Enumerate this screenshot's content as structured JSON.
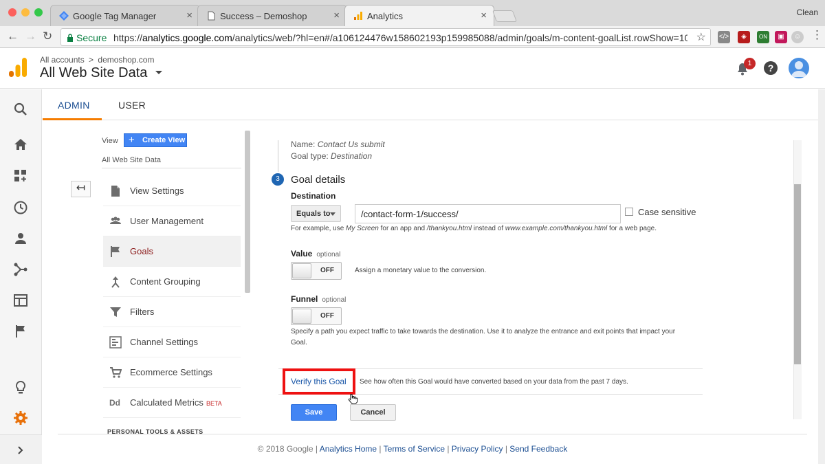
{
  "browser": {
    "profile_name": "Clean",
    "tabs": [
      {
        "title": "Google Tag Manager",
        "icon": "gtm-icon"
      },
      {
        "title": "Success – Demoshop",
        "icon": "page-icon"
      },
      {
        "title": "Analytics",
        "icon": "analytics-icon"
      }
    ],
    "secure_label": "Secure",
    "url_prefix": "https://",
    "url_host": "analytics.google.com",
    "url_path": "/analytics/web/?hl=en#/a106124476w158602193p159985088/admin/goals/m-content-goalList.rowShow=10..."
  },
  "header": {
    "all_accounts": "All accounts",
    "breadcrumb_separator": ">",
    "account": "demoshop.com",
    "view_title": "All Web Site Data",
    "notification_count": "1"
  },
  "admin_tabs": {
    "admin": "ADMIN",
    "user": "USER"
  },
  "view_column": {
    "label": "View",
    "create_view": "Create View",
    "view_name": "All Web Site Data",
    "menu": [
      {
        "label": "View Settings",
        "icon": "document-icon"
      },
      {
        "label": "User Management",
        "icon": "people-icon"
      },
      {
        "label": "Goals",
        "icon": "flag-icon"
      },
      {
        "label": "Content Grouping",
        "icon": "grouping-icon"
      },
      {
        "label": "Filters",
        "icon": "filter-icon"
      },
      {
        "label": "Channel Settings",
        "icon": "channel-icon"
      },
      {
        "label": "Ecommerce Settings",
        "icon": "cart-icon"
      },
      {
        "label": "Calculated Metrics",
        "icon": "dd-icon",
        "badge": "BETA"
      }
    ],
    "section_heading": "PERSONAL TOOLS & ASSETS"
  },
  "goal": {
    "name_label": "Name:",
    "name_value": "Contact Us submit",
    "type_label": "Goal type:",
    "type_value": "Destination",
    "step_number": "3",
    "section_title": "Goal details",
    "destination_label": "Destination",
    "match_type": "Equals to",
    "destination_value": "/contact-form-1/success/",
    "case_sensitive_label": "Case sensitive",
    "help": {
      "a": "For example, use ",
      "b": "My Screen",
      "c": " for an app and ",
      "d": "/thankyou.html",
      "e": " instead of ",
      "f": "www.example.com/thankyou.html",
      "g": " for a web page."
    },
    "value_label": "Value",
    "value_optional": "optional",
    "value_toggle": "OFF",
    "value_desc": "Assign a monetary value to the conversion.",
    "funnel_label": "Funnel",
    "funnel_optional": "optional",
    "funnel_toggle": "OFF",
    "funnel_desc_line1": "Specify a path you expect traffic to take towards the destination. Use it to analyze the entrance and exit points that impact your",
    "funnel_desc_line2": "Goal.",
    "verify_link": "Verify this Goal",
    "verify_desc": "See how often this Goal would have converted based on your data from the past 7 days.",
    "save": "Save",
    "cancel": "Cancel"
  },
  "footer": {
    "copyright": "© 2018 Google",
    "sep": " | ",
    "links": [
      "Analytics Home",
      "Terms of Service",
      "Privacy Policy",
      "Send Feedback"
    ]
  },
  "colors": {
    "accent_blue": "#4285f4",
    "admin_tab_underline": "#f57c00",
    "highlight_box": "#ee1111",
    "selected_menu_text": "#8c1c1c"
  }
}
